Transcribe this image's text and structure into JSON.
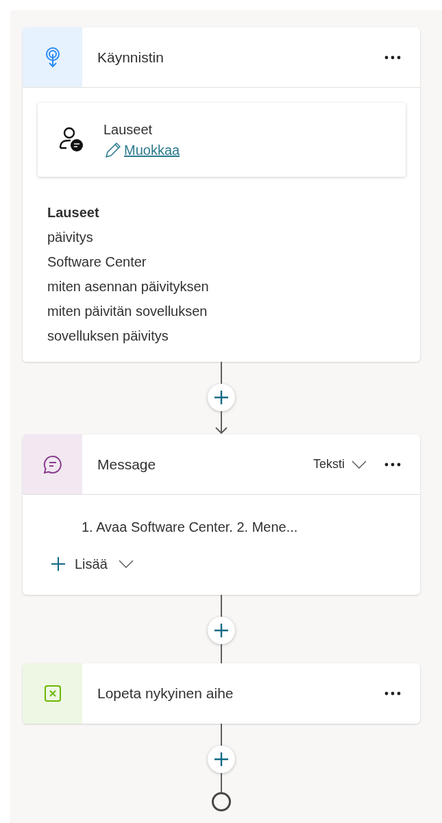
{
  "nodes": [
    {
      "kind": "trigger",
      "title": "Käynnistin",
      "phrases_card": {
        "title": "Lauseet",
        "edit_link": "Muokkaa"
      },
      "phrases": {
        "heading": "Lauseet",
        "items": [
          "päivitys",
          "Software Center",
          "miten asennan päivityksen",
          "miten päivitän sovelluksen",
          "sovelluksen päivitys"
        ]
      }
    },
    {
      "kind": "message",
      "title": "Message",
      "format_dropdown": "Teksti",
      "message_preview": "1. Avaa Software Center. 2. Mene...",
      "add_menu": "Lisää"
    },
    {
      "kind": "end",
      "title": "Lopeta nykyinen aihe"
    }
  ],
  "connectors": [
    {
      "arrow": true,
      "terminal": false
    },
    {
      "arrow": false,
      "terminal": false
    },
    {
      "arrow": false,
      "terminal": true
    }
  ]
}
